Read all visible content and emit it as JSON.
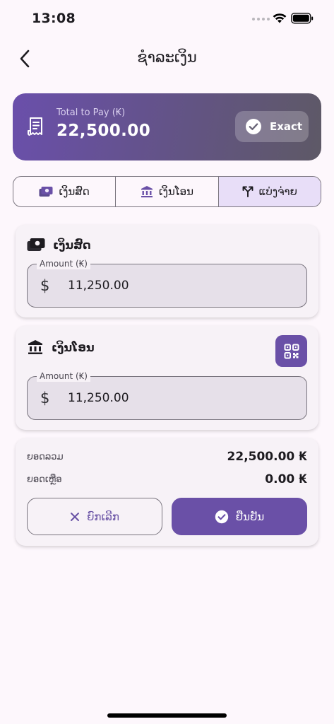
{
  "status_bar": {
    "time": "13:08"
  },
  "header": {
    "title": "ຊຳລະເງິນ"
  },
  "total_card": {
    "label": "Total to Pay (₭)",
    "value": "22,500.00",
    "exact_label": "Exact"
  },
  "tabs": [
    {
      "label": "ເງິນສົດ",
      "icon": "cash-icon"
    },
    {
      "label": "ເງິນໂອນ",
      "icon": "bank-icon"
    },
    {
      "label": "ແບ່ງຈ່າຍ",
      "icon": "split-icon",
      "active": true
    }
  ],
  "cash_card": {
    "title": "ເງິນສົດ",
    "field_label": "Amount (₭)",
    "currency_symbol": "$",
    "value": "11,250.00"
  },
  "transfer_card": {
    "title": "ເງິນໂອນ",
    "field_label": "Amount (₭)",
    "currency_symbol": "$",
    "value": "11,250.00"
  },
  "summary": {
    "total_label": "ຍອດລວມ",
    "total_value": "22,500.00 ₭",
    "remaining_label": "ຍອດເຫຼືອ",
    "remaining_value": "0.00 ₭",
    "cancel_label": "ຍົກເລີກ",
    "confirm_label": "ຢືນຢັນ"
  },
  "colors": {
    "primary": "#6A50A7",
    "background": "#FDF7FC",
    "card": "#F7F2F7",
    "segment_active": "#E8DEF8"
  }
}
